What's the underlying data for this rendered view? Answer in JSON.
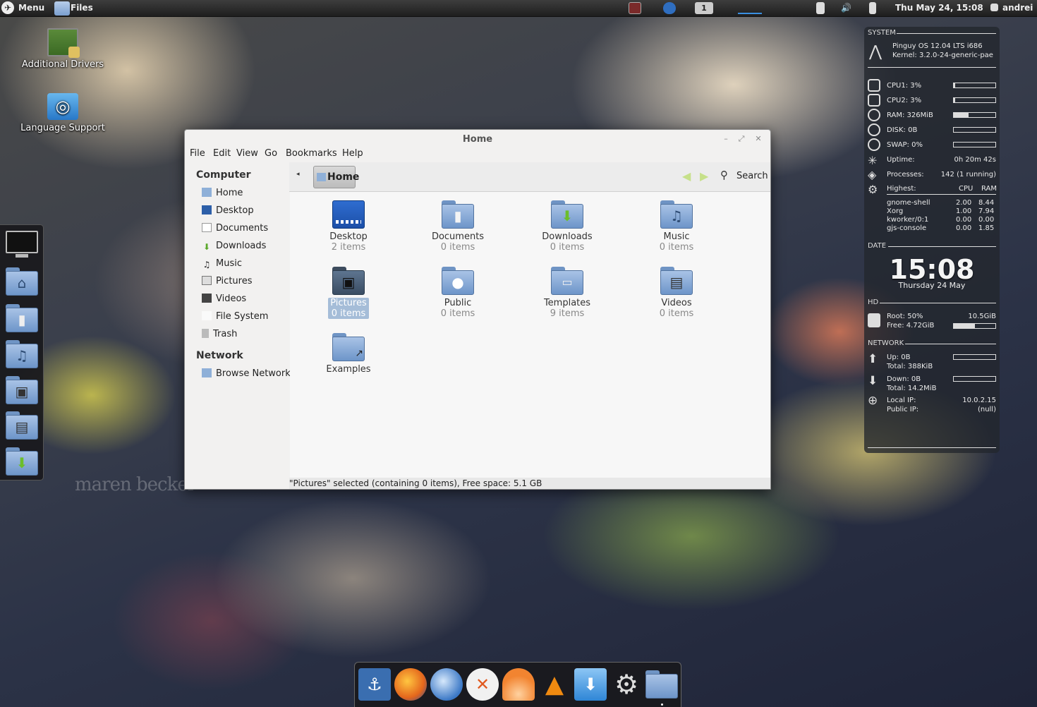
{
  "top_panel": {
    "menu_label": "Menu",
    "active_app": "Files",
    "workspace": "1",
    "datetime": "Thu May 24, 15:08",
    "user": "andrei"
  },
  "desktop": {
    "icons": [
      {
        "label": "Additional Drivers",
        "icon": "driver-board-icon"
      },
      {
        "label": "Language Support",
        "icon": "language-support-icon"
      }
    ],
    "watermark": "maren becker"
  },
  "left_dock": [
    "monitor-icon",
    "home-folder-icon",
    "documents-folder-icon",
    "music-folder-icon",
    "pictures-folder-icon",
    "videos-folder-icon",
    "downloads-folder-icon"
  ],
  "window": {
    "title": "Home",
    "menu": [
      "File",
      "Edit",
      "View",
      "Go",
      "Bookmarks",
      "Help"
    ],
    "sidebar": {
      "computer_header": "Computer",
      "computer_items": [
        "Home",
        "Desktop",
        "Documents",
        "Downloads",
        "Music",
        "Pictures",
        "Videos",
        "File System",
        "Trash"
      ],
      "network_header": "Network",
      "network_items": [
        "Browse Network"
      ]
    },
    "toolbar": {
      "path": "Home",
      "search_label": "Search"
    },
    "files": [
      {
        "name": "Desktop",
        "count": "2 items"
      },
      {
        "name": "Documents",
        "count": "0 items"
      },
      {
        "name": "Downloads",
        "count": "0 items"
      },
      {
        "name": "Music",
        "count": "0 items"
      },
      {
        "name": "Pictures",
        "count": "0 items"
      },
      {
        "name": "Public",
        "count": "0 items"
      },
      {
        "name": "Templates",
        "count": "9 items"
      },
      {
        "name": "Videos",
        "count": "0 items"
      },
      {
        "name": "Examples",
        "count": ""
      }
    ],
    "selected": "Pictures",
    "status": "\"Pictures\" selected (containing 0 items), Free space: 5.1 GB"
  },
  "conky": {
    "system_label": "SYSTEM",
    "os": "Pinguy OS 12.04 LTS i686",
    "kernel": "Kernel: 3.2.0-24-generic-pae",
    "cpu1": "CPU1: 3%",
    "cpu2": "CPU2: 3%",
    "ram": "RAM: 326MiB",
    "disk": "DISK: 0B",
    "swap": "SWAP: 0%",
    "uptime_label": "Uptime:",
    "uptime": "0h 20m 42s",
    "processes_label": "Processes:",
    "processes": "142 (1 running)",
    "highest_label": "Highest:",
    "cpu_col": "CPU",
    "ram_col": "RAM",
    "procs": [
      {
        "name": "gnome-shell",
        "cpu": "2.00",
        "ram": "8.44"
      },
      {
        "name": "Xorg",
        "cpu": "1.00",
        "ram": "7.94"
      },
      {
        "name": "kworker/0:1",
        "cpu": "0.00",
        "ram": "0.00"
      },
      {
        "name": "gjs-console",
        "cpu": "0.00",
        "ram": "1.85"
      }
    ],
    "date_label": "DATE",
    "time": "15:08",
    "date": "Thursday 24 May",
    "hd_label": "HD",
    "root": "Root: 50%",
    "root_size": "10.5GiB",
    "free": "Free: 4.72GiB",
    "network_label": "NETWORK",
    "up": "Up: 0B",
    "up_total": "Total: 388KiB",
    "down": "Down: 0B",
    "down_total": "Total: 14.2MiB",
    "local_ip_label": "Local IP:",
    "local_ip": "10.0.2.15",
    "public_ip_label": "Public IP:",
    "public_ip": "(null)",
    "levels": {
      "cpu1": 0.03,
      "cpu2": 0.03,
      "ram": 0.35,
      "disk": 0,
      "swap": 0,
      "root": 0.5,
      "up": 0,
      "down": 0
    }
  },
  "bottom_dock": [
    "anchor-icon",
    "firefox-icon",
    "thunderbird-icon",
    "chat-icon",
    "orange-slice-icon",
    "vlc-cone-icon",
    "download-icon",
    "settings-gear-icon",
    "files-folder-icon"
  ]
}
